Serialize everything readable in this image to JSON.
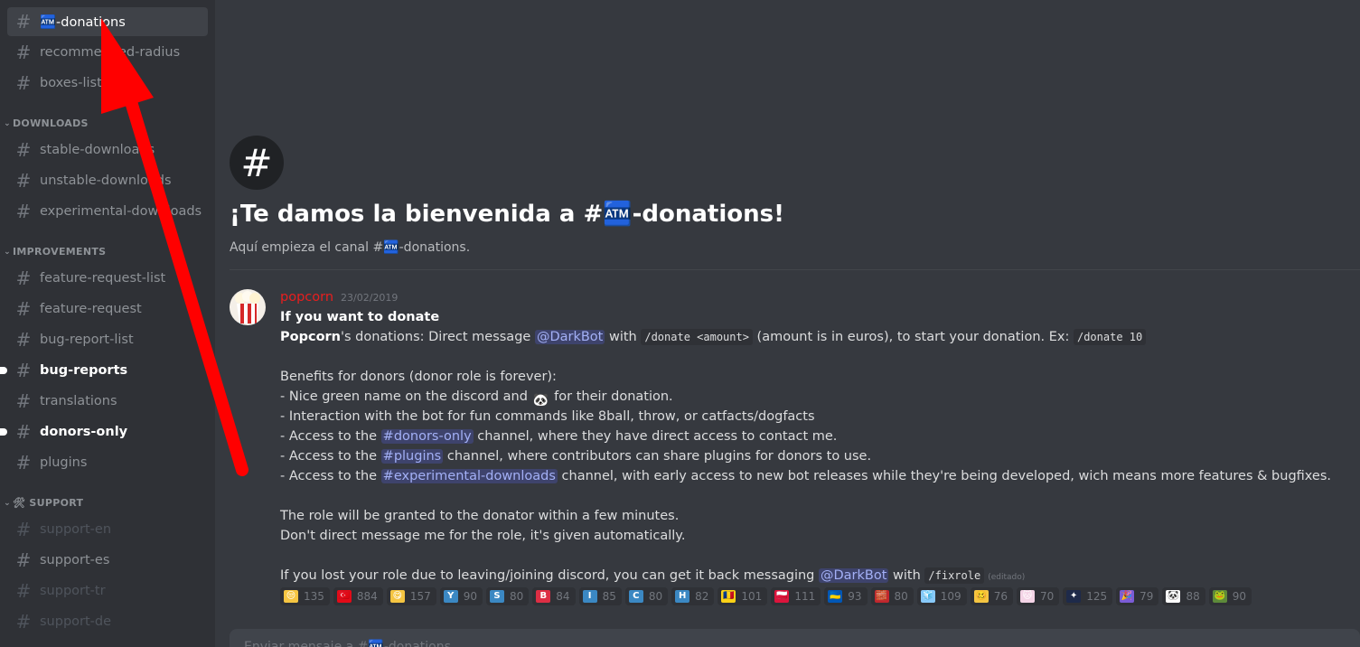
{
  "sidebar": {
    "channels_top": [
      {
        "label": "🏧-donations",
        "state": "active"
      },
      {
        "label": "recommended-radius",
        "state": "normal"
      },
      {
        "label": "boxes-list",
        "state": "normal"
      }
    ],
    "categories": [
      {
        "label": "DOWNLOADS",
        "channels": [
          {
            "label": "stable-downloads",
            "state": "normal"
          },
          {
            "label": "unstable-downloads",
            "state": "normal"
          },
          {
            "label": "experimental-downloads",
            "state": "normal"
          }
        ]
      },
      {
        "label": "IMPROVEMENTS",
        "channels": [
          {
            "label": "feature-request-list",
            "state": "normal"
          },
          {
            "label": "feature-request",
            "state": "normal"
          },
          {
            "label": "bug-report-list",
            "state": "normal"
          },
          {
            "label": "bug-reports",
            "state": "unread"
          },
          {
            "label": "translations",
            "state": "normal"
          },
          {
            "label": "donors-only",
            "state": "unread"
          },
          {
            "label": "plugins",
            "state": "normal"
          }
        ]
      },
      {
        "label": "🛠 SUPPORT",
        "channels": [
          {
            "label": "support-en",
            "state": "muted"
          },
          {
            "label": "support-es",
            "state": "normal"
          },
          {
            "label": "support-tr",
            "state": "muted"
          },
          {
            "label": "support-de",
            "state": "muted"
          }
        ]
      }
    ]
  },
  "welcome": {
    "hash_icon": "#",
    "title": "¡Te damos la bienvenida a #🏧-donations!",
    "subtitle": "Aquí empieza el canal #🏧-donations."
  },
  "message": {
    "author": "popcorn",
    "timestamp": "23/02/2019",
    "avatar_emoji": "🍿",
    "heading": "If you want to donate",
    "l1_bold": "Popcorn",
    "l1_a": "'s donations:  Direct message ",
    "mention_bot": "@DarkBot",
    "l1_b": " with ",
    "code_donate": "/donate <amount>",
    "l1_c": " (amount is in euros), to start your donation. Ex: ",
    "code_donate10": "/donate 10",
    "benefits": "Benefits for donors (donor role is forever):",
    "b1_a": " - Nice green name on the discord and ",
    "b1_emoji": "🐼",
    "b1_b": " for their donation.",
    "b2": " - Interaction with the bot for fun commands like 8ball, throw, or catfacts/dogfacts",
    "b3_a": " - Access to the ",
    "b3_ch": "#donors-only",
    "b3_b": " channel, where they have direct access to contact me.",
    "b4_a": " - Access to the ",
    "b4_ch": "#plugins",
    "b4_b": " channel, where contributors can share plugins for donors to use.",
    "b5_a": " - Access to the ",
    "b5_ch": "#experimental-downloads",
    "b5_b": " channel, with early access to new bot releases while they're being developed, wich means more features & bugfixes.",
    "role1": "The role will be granted to the donator within a few minutes.",
    "role2": "Don't direct message me for the role, it's given automatically.",
    "lost_a": "If you lost your role due to leaving/joining discord, you can get it back messaging ",
    "lost_mention": "@DarkBot",
    "lost_b": " with ",
    "code_fixrole": "/fixrole",
    "edited": "(editado)"
  },
  "reactions": [
    {
      "emoji": "😒",
      "count": "135",
      "color": "#f5c542"
    },
    {
      "emoji": "🇹🇷",
      "count": "884",
      "color": "#e30a17"
    },
    {
      "emoji": "😋",
      "count": "157",
      "color": "#f5c542"
    },
    {
      "emoji": "Y",
      "count": "90",
      "color": "#3b88c3"
    },
    {
      "emoji": "S",
      "count": "80",
      "color": "#3b88c3"
    },
    {
      "emoji": "B",
      "count": "84",
      "color": "#dd2e44"
    },
    {
      "emoji": "I",
      "count": "85",
      "color": "#3b88c3"
    },
    {
      "emoji": "C",
      "count": "80",
      "color": "#3b88c3"
    },
    {
      "emoji": "H",
      "count": "82",
      "color": "#3b88c3"
    },
    {
      "emoji": "🇷🇴",
      "count": "101",
      "color": "#fcd116"
    },
    {
      "emoji": "🇵🇱",
      "count": "111",
      "color": "#dc143c"
    },
    {
      "emoji": "🇺🇦",
      "count": "93",
      "color": "#0057b7"
    },
    {
      "emoji": "🧱",
      "count": "80",
      "color": "#c1272d"
    },
    {
      "emoji": "🧊",
      "count": "109",
      "color": "#88c9f9"
    },
    {
      "emoji": "🥴",
      "count": "76",
      "color": "#f5c542"
    },
    {
      "emoji": "🐱",
      "count": "70",
      "color": "#f4d4e6"
    },
    {
      "emoji": "✦",
      "count": "125",
      "color": "#1e2a4a"
    },
    {
      "emoji": "🎉",
      "count": "79",
      "color": "#7b5cd6"
    },
    {
      "emoji": "🐼",
      "count": "88",
      "color": "#ffffff"
    },
    {
      "emoji": "🐸",
      "count": "90",
      "color": "#5d8a3a"
    }
  ],
  "input": {
    "placeholder": "Enviar mensaje a #🏧-donations"
  },
  "colors": {
    "author": "#e91e1e",
    "arrow": "#ff0000",
    "sidebar_bg": "#2f3136",
    "main_bg": "#36393f"
  }
}
